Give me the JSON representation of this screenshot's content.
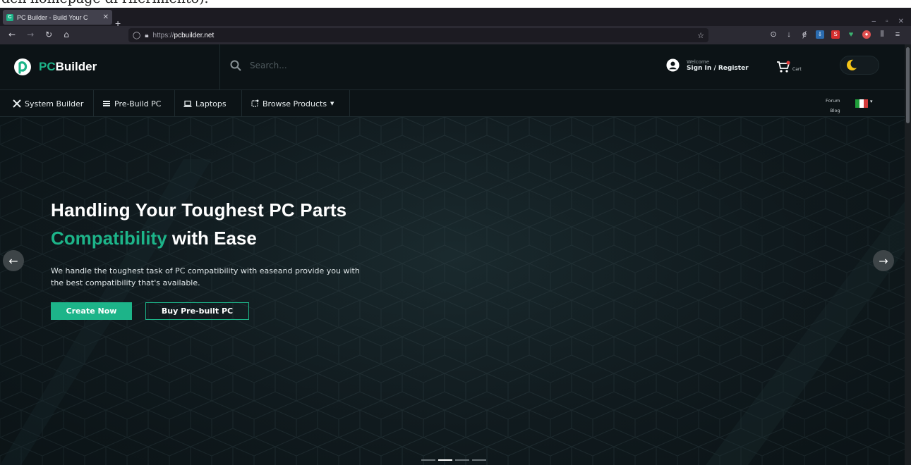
{
  "top_strip": {
    "text": "dell'homepage di riferimento)."
  },
  "browser": {
    "tab_title": "PC Builder - Build Your C",
    "tab_favicon": "C",
    "new_tab": "+",
    "url_proto": "https://",
    "url_host": "pcbuilder.net",
    "window_controls": [
      "–",
      "▫",
      "✕"
    ]
  },
  "site": {
    "brand_pc": "PC",
    "brand_rest": "Builder",
    "search_placeholder": "Search...",
    "welcome": "Welcome",
    "sign_in": "Sign In / Register",
    "cart_label": "Cart",
    "menu": {
      "system_builder": "System Builder",
      "pre_build": "Pre-Build PC",
      "laptops": "Laptops",
      "browse_products": "Browse Products"
    },
    "forum": "Forum",
    "blog": "Blog",
    "colors": {
      "accent": "#1db489",
      "background": "#0f1a1e",
      "header": "#0c1316"
    }
  },
  "hero": {
    "title_line1": "Handling Your Toughest PC Parts",
    "title_accent": "Compatibility",
    "title_line2_rest": " with Ease",
    "description": "We handle the toughest task of PC compatibility with easeand provide you with the best compatibility that's available.",
    "cta_primary": "Create Now",
    "cta_secondary": "Buy Pre-built PC",
    "slides": [
      {
        "active": false
      },
      {
        "active": true
      },
      {
        "active": false
      },
      {
        "active": false
      }
    ]
  },
  "icons": [
    "back-arrow-icon",
    "forward-arrow-icon",
    "reload-icon",
    "home-icon",
    "shield-icon",
    "lock-icon",
    "star-icon",
    "user-icon",
    "cart-icon",
    "moon-icon",
    "search-icon",
    "tools-icon",
    "list-icon",
    "laptop-icon",
    "chip-icon",
    "flag-italy-icon"
  ]
}
